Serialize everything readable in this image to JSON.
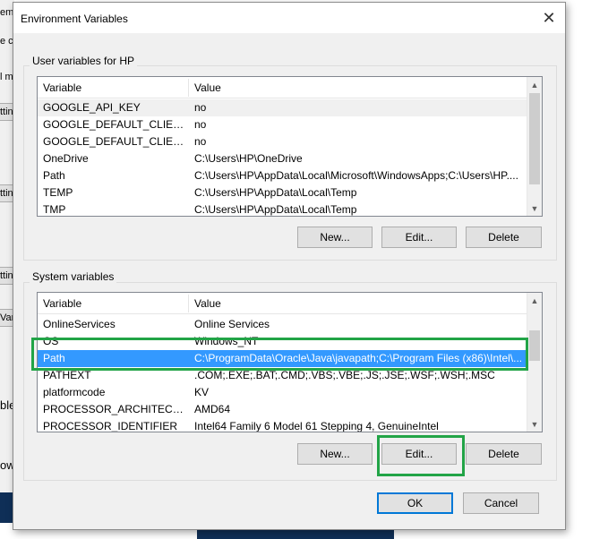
{
  "background": {
    "fragments": [
      "em",
      "e c",
      "l m",
      "tting",
      "tting",
      "tting",
      "Var",
      "ble",
      "ow"
    ]
  },
  "dialog": {
    "title": "Environment Variables",
    "user_group_label": "User variables for HP",
    "system_group_label": "System variables",
    "columns": {
      "variable": "Variable",
      "value": "Value"
    },
    "user_vars": [
      {
        "name": "GOOGLE_API_KEY",
        "value": "no"
      },
      {
        "name": "GOOGLE_DEFAULT_CLIENT_ID",
        "value": "no"
      },
      {
        "name": "GOOGLE_DEFAULT_CLIENT_S...",
        "value": "no"
      },
      {
        "name": "OneDrive",
        "value": "C:\\Users\\HP\\OneDrive"
      },
      {
        "name": "Path",
        "value": "C:\\Users\\HP\\AppData\\Local\\Microsoft\\WindowsApps;C:\\Users\\HP...."
      },
      {
        "name": "TEMP",
        "value": "C:\\Users\\HP\\AppData\\Local\\Temp"
      },
      {
        "name": "TMP",
        "value": "C:\\Users\\HP\\AppData\\Local\\Temp"
      }
    ],
    "system_vars": [
      {
        "name": "OnlineServices",
        "value": "Online Services"
      },
      {
        "name": "OS",
        "value": "Windows_NT"
      },
      {
        "name": "Path",
        "value": "C:\\ProgramData\\Oracle\\Java\\javapath;C:\\Program Files (x86)\\Intel\\..."
      },
      {
        "name": "PATHEXT",
        "value": ".COM;.EXE;.BAT;.CMD;.VBS;.VBE;.JS;.JSE;.WSF;.WSH;.MSC"
      },
      {
        "name": "platformcode",
        "value": "KV"
      },
      {
        "name": "PROCESSOR_ARCHITECTURE",
        "value": "AMD64"
      },
      {
        "name": "PROCESSOR_IDENTIFIER",
        "value": "Intel64 Family 6 Model 61 Stepping 4, GenuineIntel"
      }
    ],
    "selected_system_var": "Path",
    "buttons": {
      "user_new": "New...",
      "user_edit": "Edit...",
      "user_delete": "Delete",
      "system_new": "New...",
      "system_edit": "Edit...",
      "system_delete": "Delete",
      "ok": "OK",
      "cancel": "Cancel"
    },
    "highlight_color": "#22a447",
    "selection_color": "#3399ff"
  }
}
